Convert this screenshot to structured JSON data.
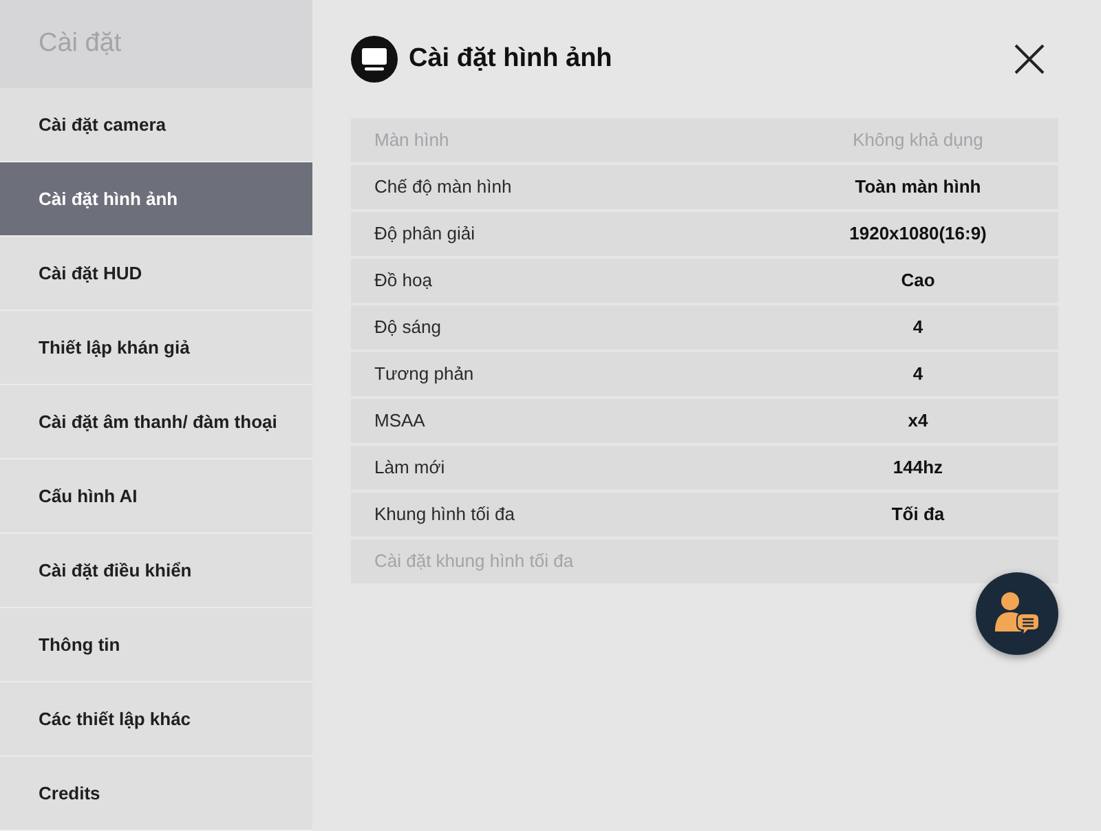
{
  "sidebar": {
    "title": "Cài đặt",
    "items": [
      {
        "label": "Cài đặt camera",
        "selected": false
      },
      {
        "label": "Cài đặt hình ảnh",
        "selected": true
      },
      {
        "label": "Cài đặt HUD",
        "selected": false
      },
      {
        "label": "Thiết lập khán giả",
        "selected": false
      },
      {
        "label": "Cài đặt âm thanh/ đàm thoại",
        "selected": false
      },
      {
        "label": "Cấu hình AI",
        "selected": false
      },
      {
        "label": "Cài đặt điều khiển",
        "selected": false
      },
      {
        "label": "Thông tin",
        "selected": false
      },
      {
        "label": "Các thiết lập khác",
        "selected": false
      },
      {
        "label": "Credits",
        "selected": false
      }
    ]
  },
  "panel": {
    "title": "Cài đặt hình ảnh",
    "rows": [
      {
        "label": "Màn hình",
        "value": "Không khả dụng",
        "disabled": true
      },
      {
        "label": "Chế độ màn hình",
        "value": "Toàn màn hình",
        "disabled": false
      },
      {
        "label": "Độ phân giải",
        "value": "1920x1080(16:9)",
        "disabled": false
      },
      {
        "label": "Đồ hoạ",
        "value": "Cao",
        "disabled": false
      },
      {
        "label": "Độ sáng",
        "value": "4",
        "disabled": false
      },
      {
        "label": "Tương phản",
        "value": "4",
        "disabled": false
      },
      {
        "label": "MSAA",
        "value": "x4",
        "disabled": false
      },
      {
        "label": "Làm mới",
        "value": "144hz",
        "disabled": false
      },
      {
        "label": "Khung hình tối đa",
        "value": "Tối đa",
        "disabled": false
      },
      {
        "label": "Cài đặt khung hình tối đa",
        "disabled": true
      }
    ]
  }
}
